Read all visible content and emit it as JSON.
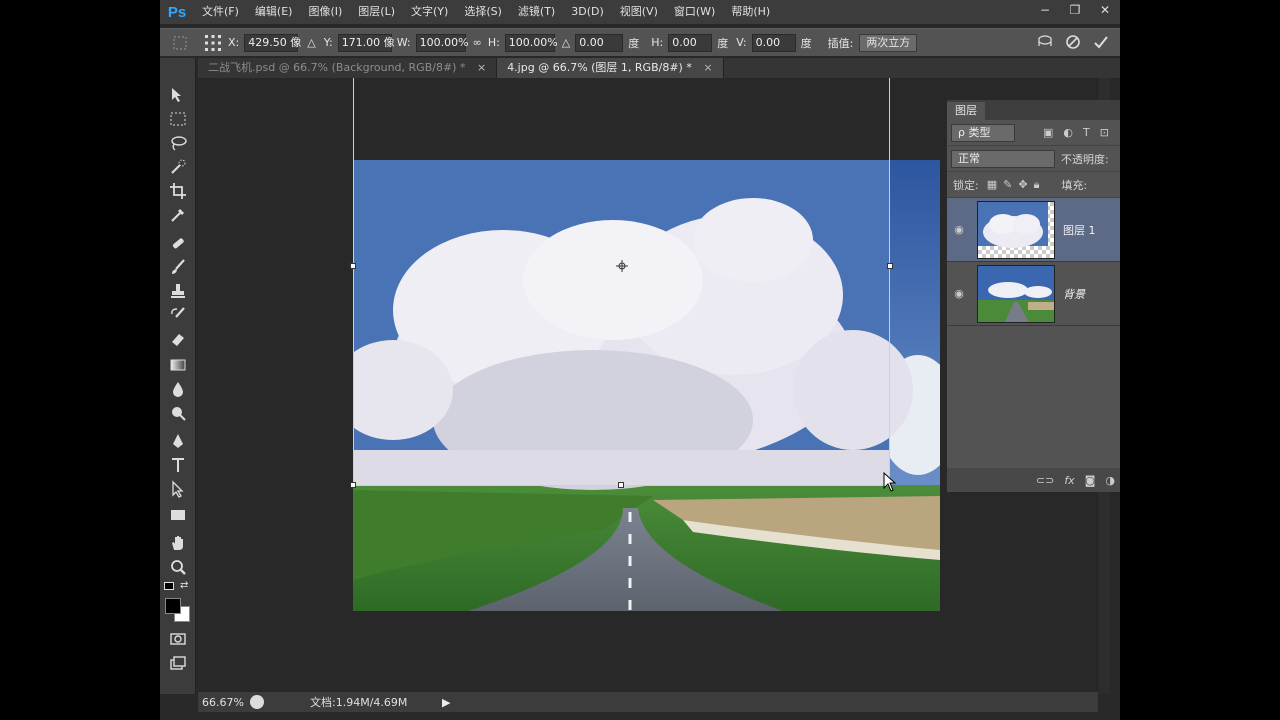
{
  "app": {
    "logo": "Ps"
  },
  "menu": [
    "文件(F)",
    "编辑(E)",
    "图像(I)",
    "图层(L)",
    "文字(Y)",
    "选择(S)",
    "滤镜(T)",
    "3D(D)",
    "视图(V)",
    "窗口(W)",
    "帮助(H)"
  ],
  "window_controls": {
    "minimize": "−",
    "restore": "❐",
    "close": "✕"
  },
  "options": {
    "x_label": "X:",
    "x_value": "429.50 像",
    "delta_label": "△",
    "y_label": "Y:",
    "y_value": "171.00 像",
    "w_label": "W:",
    "w_value": "100.00%",
    "link_icon": "∞",
    "h_label": "H:",
    "h_value": "100.00%",
    "angle_label": "△",
    "angle_value": "0.00",
    "angle_unit": "度",
    "hskew_label": "H:",
    "hskew_value": "0.00",
    "hskew_unit": "度",
    "vskew_label": "V:",
    "vskew_value": "0.00",
    "vskew_unit": "度",
    "interp_label": "插值:",
    "interp_value": "两次立方"
  },
  "tabs": [
    {
      "label": "二战飞机.psd @ 66.7% (Background, RGB/8#) *",
      "close": "×"
    },
    {
      "label": "4.jpg @ 66.7% (图层 1, RGB/8#) *",
      "close": "×"
    }
  ],
  "status": {
    "zoom": "66.67%",
    "doc": "文档:1.94M/4.69M"
  },
  "layers_panel": {
    "tab": "图层",
    "filter": "ρ 类型",
    "blend_mode": "正常",
    "opacity_label": "不透明度:",
    "lock_label": "锁定:",
    "fill_label": "填充:",
    "layers": [
      {
        "name": "图层 1",
        "selected": true
      },
      {
        "name": "背景",
        "selected": false
      }
    ],
    "footer_icons": [
      "link-icon",
      "fx-icon",
      "mask-icon",
      "adjustment-icon"
    ]
  },
  "colors": {
    "bg": "#282828",
    "panel": "#535353",
    "menubar": "#3c3c3c",
    "accent": "#31a8ff",
    "selection": "#5c6a85"
  }
}
